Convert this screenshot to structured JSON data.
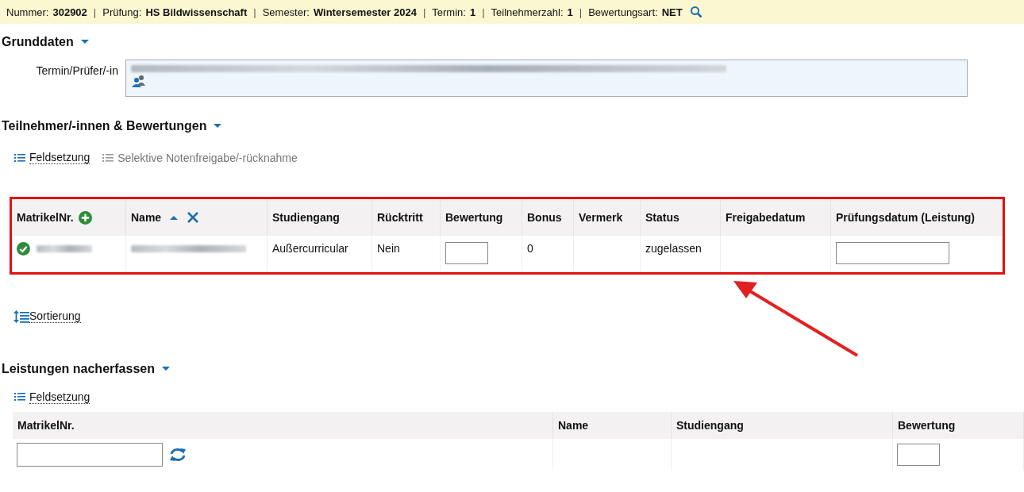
{
  "header_bar": {
    "separator": "|",
    "items": [
      {
        "label": "Nummer:",
        "value": "302902"
      },
      {
        "label": "Prüfung:",
        "value": "HS Bildwissenschaft"
      },
      {
        "label": "Semester:",
        "value": "Wintersemester 2024"
      },
      {
        "label": "Termin:",
        "value": "1"
      },
      {
        "label": "Teilnehmerzahl:",
        "value": "1"
      },
      {
        "label": "Bewertungsart:",
        "value": "NET"
      }
    ]
  },
  "grunddaten": {
    "title": "Grunddaten",
    "expanded": true,
    "field_label": "Termin/Prüfer/-in"
  },
  "participants": {
    "title": "Teilnehmer/-innen & Bewertungen",
    "expanded": true,
    "toolbar": [
      {
        "label": "Feldsetzung",
        "disabled": false
      },
      {
        "label": "Selektive Notenfreigabe/-rücknahme",
        "disabled": true
      }
    ],
    "columns": [
      {
        "label": "MatrikelNr.",
        "kind": "add"
      },
      {
        "label": "Name",
        "kind": "sort"
      },
      {
        "label": "Studiengang",
        "kind": "plain"
      },
      {
        "label": "Rücktritt",
        "kind": "plain"
      },
      {
        "label": "Bewertung",
        "kind": "plain"
      },
      {
        "label": "Bonus",
        "kind": "plain"
      },
      {
        "label": "Vermerk",
        "kind": "plain"
      },
      {
        "label": "Status",
        "kind": "plain"
      },
      {
        "label": "Freigabedatum",
        "kind": "plain"
      },
      {
        "label": "Prüfungsdatum (Leistung)",
        "kind": "plain"
      }
    ],
    "rows": [
      {
        "valid": true,
        "studiengang": "Außercurricular",
        "ruecktritt": "Nein",
        "bonus": "0",
        "status": "zugelassen"
      }
    ],
    "sort_link": "Sortierung"
  },
  "nacherfassen": {
    "title": "Leistungen nacherfassen",
    "expanded": true,
    "toolbar_link": "Feldsetzung",
    "columns": [
      "MatrikelNr.",
      "Name",
      "Studiengang",
      "Bewertung"
    ]
  }
}
